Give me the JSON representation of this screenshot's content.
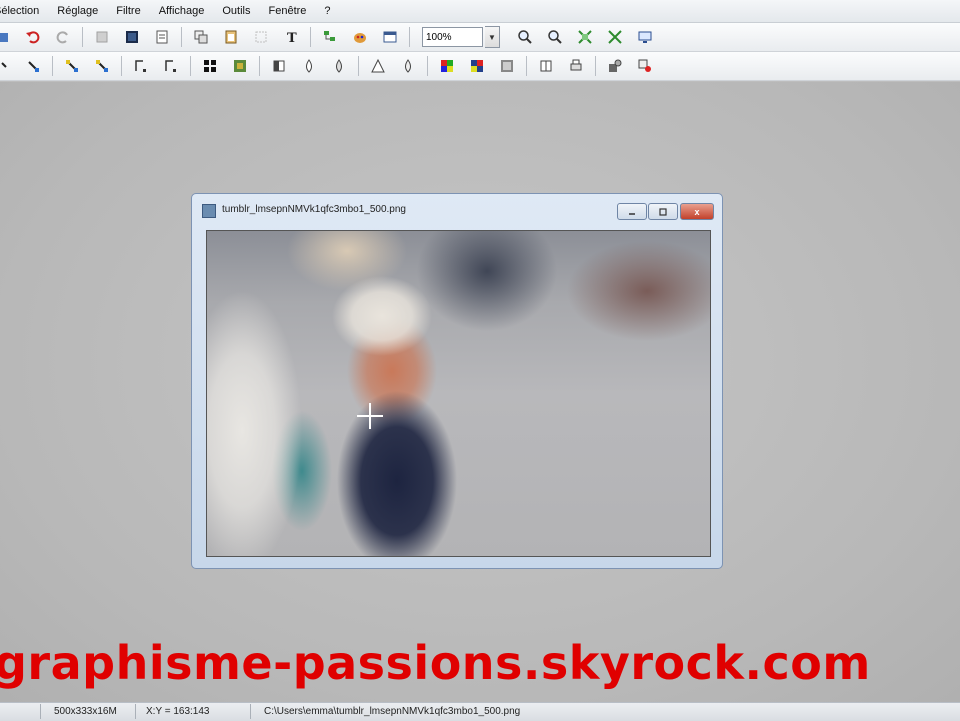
{
  "menubar": {
    "items": [
      "Sélection",
      "Réglage",
      "Filtre",
      "Affichage",
      "Outils",
      "Fenêtre",
      "?"
    ]
  },
  "toolbar": {
    "zoom_value": "100%"
  },
  "image_window": {
    "title": "tumblr_lmsepnNMVk1qfc3mbo1_500.png",
    "close_glyph": "x"
  },
  "watermark": "graphisme-passions.skyrock.com",
  "statusbar": {
    "dimensions": "500x333x16M",
    "coords": "X:Y = 163:143",
    "path": "C:\\Users\\emma\\tumblr_lmsepnNMVk1qfc3mbo1_500.png"
  },
  "colors": {
    "undo_red": "#cc2222",
    "watermark_red": "#e00000",
    "close_red": "#c2412b"
  }
}
